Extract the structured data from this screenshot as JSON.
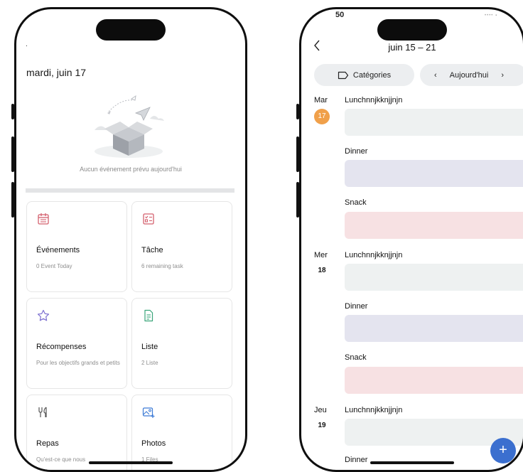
{
  "left_phone": {
    "header_dot": ".",
    "date": "mardi, juin 17",
    "empty_message": "Aucun événement prévu aujourd'hui",
    "cards": [
      {
        "title": "Événements",
        "subtitle": "0 Event Today",
        "icon": "calendar-icon"
      },
      {
        "title": "Tâche",
        "subtitle": "6 remaining task",
        "icon": "checklist-icon"
      },
      {
        "title": "Récompenses",
        "subtitle": "Pour les objectifs grands et petits",
        "icon": "star-icon"
      },
      {
        "title": "Liste",
        "subtitle": "2 Liste",
        "icon": "list-document-icon"
      },
      {
        "title": "Repas",
        "subtitle": "Qu'est-ce que nous",
        "icon": "utensils-icon"
      },
      {
        "title": "Photos",
        "subtitle": "1 Files",
        "icon": "photo-add-icon"
      }
    ],
    "colors": {
      "accent_red": "#d4606e",
      "accent_purple": "#7c6fd0",
      "accent_green": "#3aa57a",
      "accent_blue": "#3d7bd6"
    }
  },
  "right_phone": {
    "status_time": "50",
    "week_title": "juin 15 – 21",
    "categories_label": "Catégories",
    "today_label": "Aujourd'hui",
    "days": [
      {
        "name": "Mar",
        "number": "17",
        "is_today": true,
        "events": [
          {
            "label": "Lunchnnjkknjjnjn",
            "type": "lunch"
          },
          {
            "label": "Dinner",
            "type": "dinner"
          },
          {
            "label": "Snack",
            "type": "snack"
          }
        ]
      },
      {
        "name": "Mer",
        "number": "18",
        "is_today": false,
        "events": [
          {
            "label": "Lunchnnjkknjjnjn",
            "type": "lunch"
          },
          {
            "label": "Dinner",
            "type": "dinner"
          },
          {
            "label": "Snack",
            "type": "snack"
          }
        ]
      },
      {
        "name": "Jeu",
        "number": "19",
        "is_today": false,
        "events": [
          {
            "label": "Lunchnnjkknjjnjn",
            "type": "lunch"
          },
          {
            "label": "Dinner",
            "type": "dinner"
          }
        ]
      }
    ],
    "fab_label": "+",
    "colors": {
      "today_badge": "#f0a04a",
      "fab": "#3b6fcf"
    }
  }
}
